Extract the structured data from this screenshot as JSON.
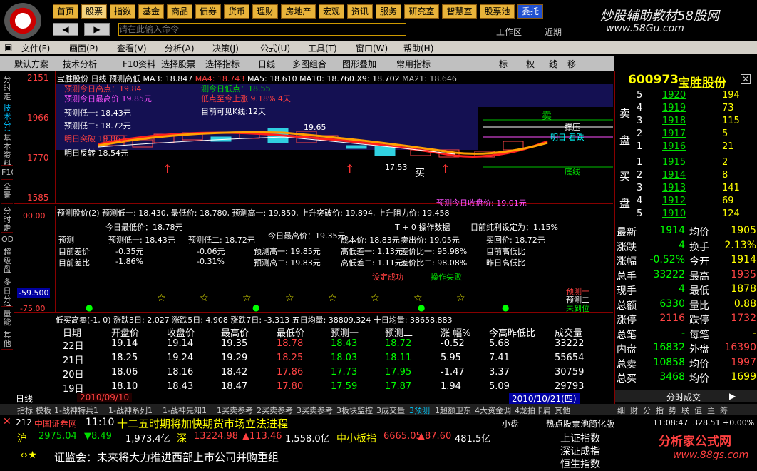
{
  "nav": [
    "首页",
    "股票",
    "指数",
    "基金",
    "商品",
    "债券",
    "货币",
    "理财",
    "房地产",
    "宏观",
    "资讯",
    "服务",
    "研究室",
    "智慧室",
    "股票池",
    "委托"
  ],
  "brand": "炒股辅助教材58股网",
  "brand_url": "www.58Gu.com",
  "cmd_placeholder": "请在此输入命令",
  "workarea": "工作区",
  "recent": "近期",
  "menu": [
    "文件(F)",
    "画面(P)",
    "查看(V)",
    "分析(A)",
    "决策(J)",
    "公式(U)",
    "工具(T)",
    "窗口(W)",
    "帮助(H)"
  ],
  "toolbar": [
    "默认方案",
    "技术分析",
    "F10资料",
    "选择股票",
    "选择指标",
    "日线",
    "多图组合",
    "图形叠加",
    "常用指标",
    "标",
    "权",
    "线",
    "移"
  ],
  "left_tabs": [
    "分时走势",
    "技术分析",
    "基本资料",
    "F10",
    "全景",
    "分时走势",
    "ODD",
    "超级盘口",
    "多日分时",
    "量能",
    "其他"
  ],
  "stock": {
    "code": "600973",
    "name": "宝胜股份"
  },
  "ma_line": {
    "label": "宝胜股份 日线 预测高低",
    "ma3": "MA3: 18.847",
    "ma4": "MA4: 18.743",
    "ma5": "MA5: 18.610",
    "ma10": "MA10: 18.760",
    "x9": "X9: 18.702",
    "ma21": "MA21: 18.646"
  },
  "price_axis": [
    "2151",
    "1966",
    "1770",
    "1585"
  ],
  "chart_notes": {
    "high_today": "预测今日高点：19.84",
    "best_high": "预测今日最高价 19.85元",
    "low1": "预测低一: 18.43元",
    "low2": "预测低二: 18.72元",
    "low_today": "测今日低点：18.55",
    "low_ratio": "低点至今上涨 9.18% 4天",
    "visible_k": "目前可见K线:12天",
    "break": "明日突破 19.86元",
    "rebound": "明日反转 18.54元",
    "p1965": "19.65",
    "p1753": "17.53",
    "buy": "买",
    "sell": "卖",
    "pressure": "撑压",
    "tomorrow": "明日 看跌",
    "bottom": "底线",
    "close_pred": "预测今日收盘价: 19.01元"
  },
  "panel2": {
    "header": "预测股价(2) 预测低一: 18.430, 最低价: 18.780, 预测高一: 19.850, 上升突破价: 19.894, 上升阻力价: 19.458",
    "axis": [
      "00.00",
      "-59.500",
      "-75.00"
    ],
    "low_today": "今日最低价：18.78元",
    "high_today": "今日最高价：19.35元",
    "t0": "T + 0 操作数据",
    "net": "目前纯利设定为：1.15%",
    "r1": [
      "预测",
      "预测低一: 18.43元",
      "预测低二: 18.72元",
      "成本价: 18.83元",
      "卖出价: 19.05元",
      "买回价: 18.72元"
    ],
    "r2": [
      "目前差价",
      "-0.35元",
      "-0.06元",
      "预测高一: 19.85元",
      "高低差一: 1.13元",
      "差价比一: 95.98%",
      "目前高低比"
    ],
    "r3": [
      "目前差比",
      "-1.86%",
      "-0.31%",
      "预测高二: 19.83元",
      "高低差二: 1.11元",
      "差价比二: 98.08%",
      "昨日高低比"
    ],
    "set_ok": "设定成功",
    "fail": "操作失败",
    "pred1": "预测一",
    "pred2": "预测二",
    "unset": "未到位"
  },
  "panel3": {
    "header": "低买高卖(-1, 0) 涨跌3日: 2.027 涨跌5日: 4.908 涨跌7日: -3.313 五日均量: 38809.324 十日均量: 38658.883"
  },
  "table": {
    "headers": [
      "日期",
      "开盘价",
      "收盘价",
      "最高价",
      "最低价",
      "预测一",
      "预测二",
      "涨 幅%",
      "今高昨低比",
      "成交量"
    ],
    "rows": [
      [
        "22日",
        "19.14",
        "19.14",
        "19.35",
        "18.78",
        "18.43",
        "18.72",
        "-0.52",
        "5.68",
        "33222"
      ],
      [
        "21日",
        "18.25",
        "19.24",
        "19.29",
        "18.25",
        "18.03",
        "18.11",
        "5.95",
        "7.41",
        "55654"
      ],
      [
        "20日",
        "18.06",
        "18.16",
        "18.42",
        "17.86",
        "17.73",
        "17.95",
        "-1.47",
        "3.37",
        "30759"
      ],
      [
        "19日",
        "18.10",
        "18.43",
        "18.47",
        "17.80",
        "17.59",
        "17.87",
        "1.94",
        "5.09",
        "29793"
      ]
    ]
  },
  "date_left": "2010/09/10",
  "date_right": "2010/10/21(四)",
  "period": "日线",
  "bottom_tabs": [
    "指标",
    "模板",
    "1-战神特兵1",
    "1-战神系列1",
    "1-战神先知1",
    "1买卖参考",
    "2买卖参考",
    "3买卖参考",
    "3板块监控",
    "3成交量",
    "3预测",
    "1超额卫东",
    "4大资金调",
    "4龙拍卡肩",
    "其他"
  ],
  "right_tabs": [
    "细",
    "财",
    "分",
    "指",
    "势",
    "联",
    "值",
    "主",
    "筹"
  ],
  "news": {
    "num": "212",
    "src": "中国证券网",
    "time": "11:10",
    "text": "十二五时期将加快期货市场立法进程"
  },
  "index": {
    "sh_label": "沪",
    "sh": "2975.04",
    "sh_chg": "8.49",
    "sh_amt": "1,973.4亿",
    "sz_label": "深",
    "sz": "13224.98",
    "sz_chg": "113.46",
    "sz_amt": "1,558.0亿",
    "zx_label": "中小板指",
    "zx": "6665.05",
    "zx_chg": "87.60",
    "zx_amt": "481.5亿"
  },
  "ticker": "证监会：未来将大力推进西部上市公司并购重组",
  "idx_btns": [
    "上证指数",
    "深证成指",
    "恒生指数"
  ],
  "hot": "热点股票池简化版:热点板",
  "clock": "11:08:47",
  "conn": "328.51 +0.00%",
  "site": "分析家公式网",
  "site_url": "www.88gs.com",
  "small": "小盘",
  "orderbook": {
    "sell": [
      [
        "5",
        "1920",
        "194"
      ],
      [
        "4",
        "1919",
        "73"
      ],
      [
        "3",
        "1918",
        "115"
      ],
      [
        "2",
        "1917",
        "5"
      ],
      [
        "1",
        "1916",
        "21"
      ]
    ],
    "buy": [
      [
        "1",
        "1915",
        "2"
      ],
      [
        "2",
        "1914",
        "8"
      ],
      [
        "3",
        "1913",
        "141"
      ],
      [
        "4",
        "1912",
        "69"
      ],
      [
        "5",
        "1910",
        "124"
      ]
    ],
    "sell_label": [
      "卖",
      "盘"
    ],
    "buy_label": [
      "买",
      "盘"
    ]
  },
  "quote": [
    [
      "最新",
      "1914",
      "均价",
      "1905"
    ],
    [
      "涨跌",
      "4",
      "换手",
      "2.13%"
    ],
    [
      "涨幅",
      "-0.52%",
      "今开",
      "1914"
    ],
    [
      "总手",
      "33222",
      "最高",
      "1935"
    ],
    [
      "现手",
      "4",
      "最低",
      "1878"
    ],
    [
      "总额",
      "6330",
      "量比",
      "0.88"
    ],
    [
      "涨停",
      "2116",
      "跌停",
      "1732"
    ],
    [
      "总笔",
      "-",
      "每笔",
      "-"
    ],
    [
      "内盘",
      "16832",
      "外盘",
      "16390"
    ],
    [
      "总卖",
      "10858",
      "均价",
      "1997"
    ],
    [
      "总买",
      "3468",
      "均价",
      "1699"
    ]
  ],
  "tick_btn": "分时成交"
}
